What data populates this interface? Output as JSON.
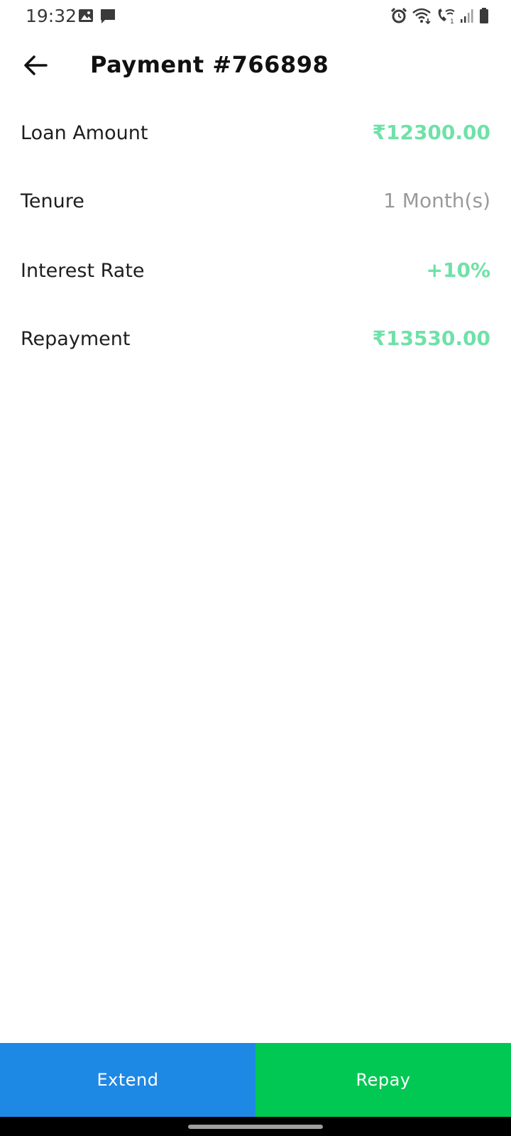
{
  "status_bar": {
    "time": "19:32",
    "left_icons": [
      "image-icon",
      "message-icon"
    ],
    "right_icons": [
      "alarm-icon",
      "wifi-icon",
      "wifi-call-icon",
      "signal-icon",
      "battery-icon"
    ]
  },
  "header": {
    "back_icon": "arrow-left-icon",
    "title": "Payment #766898"
  },
  "details": [
    {
      "label": "Loan Amount",
      "value": "₹12300.00"
    },
    {
      "label": "Tenure",
      "value": "1 Month(s)"
    },
    {
      "label": "Interest Rate",
      "value": "+10%"
    },
    {
      "label": "Repayment",
      "value": "₹13530.00"
    }
  ],
  "actions": {
    "extend_label": "Extend",
    "repay_label": "Repay"
  },
  "colors": {
    "accent_green_text": "#6fe1a8",
    "extend_button": "#1e88e5",
    "repay_button": "#00c853",
    "muted_text": "#9a9a9a"
  }
}
